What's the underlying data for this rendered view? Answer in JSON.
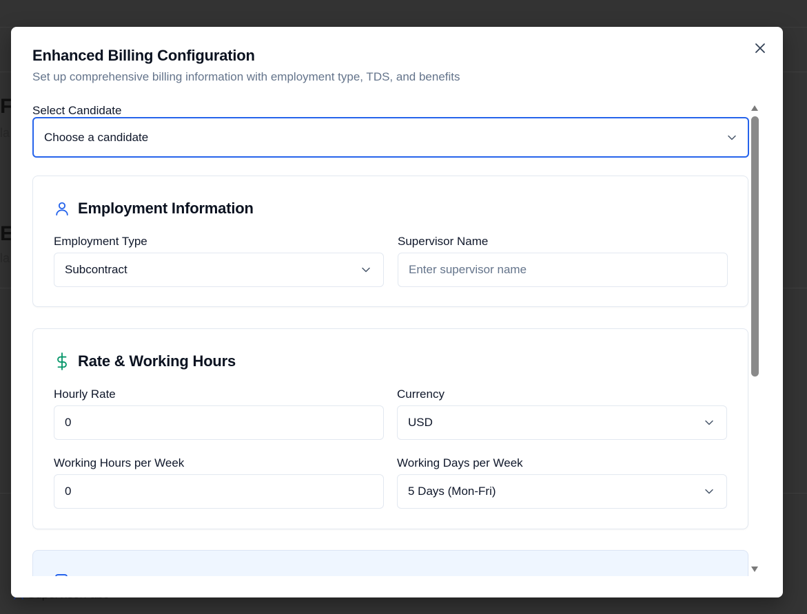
{
  "background": {
    "fragment_1": "Fi",
    "fragment_1_sub": "la",
    "fragment_2": "Er",
    "fragment_2_sub": "la",
    "footer_text": "Supervisor: abc"
  },
  "modal": {
    "title": "Enhanced Billing Configuration",
    "subtitle": "Set up comprehensive billing information with employment type, TDS, and benefits",
    "close_icon": "close-icon"
  },
  "candidate": {
    "label": "Select Candidate",
    "value": "Choose a candidate"
  },
  "employment": {
    "title": "Employment Information",
    "icon": "user-icon",
    "icon_color": "#2563eb",
    "type_label": "Employment Type",
    "type_value": "Subcontract",
    "supervisor_label": "Supervisor Name",
    "supervisor_placeholder": "Enter supervisor name"
  },
  "rate": {
    "title": "Rate & Working Hours",
    "icon": "dollar-icon",
    "icon_color": "#059669",
    "hourly_label": "Hourly Rate",
    "hourly_value": "0",
    "currency_label": "Currency",
    "currency_value": "USD",
    "hours_label": "Working Hours per Week",
    "hours_value": "0",
    "days_label": "Working Days per Week",
    "days_value": "5 Days (Mon-Fri)"
  },
  "colors": {
    "accent": "#2563eb",
    "muted_text": "#64748b",
    "border": "#e2e8f0",
    "info_card_bg": "#eff6ff"
  }
}
